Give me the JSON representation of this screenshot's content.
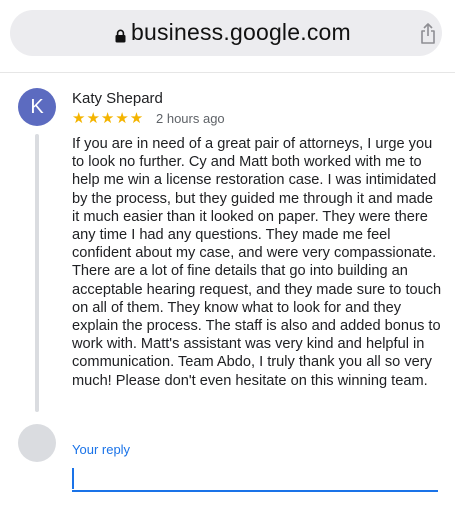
{
  "browser": {
    "url": "business.google.com",
    "lock_icon": "lock-icon",
    "share_icon": "share-icon"
  },
  "review": {
    "avatar_letter": "K",
    "avatar_color": "#5c6bc0",
    "author": "Katy Shepard",
    "rating": 5,
    "stars": "★★★★★",
    "star_color": "#f4b400",
    "time_ago": "2 hours ago",
    "text": "If you are in need of a great pair of attorneys, I urge you to look no further. Cy and Matt both worked with me to help me win a license restoration case. I was intimidated by the process, but they guided me through it and made it much easier than it looked on paper. They were there any time I had any questions. They made me feel confident about my case, and were very compassionate. There are a lot of fine details that go into building an acceptable hearing request, and they made sure to touch on all of them. They know what to look for and they explain the process. The staff is also and added bonus to work with. Matt's assistant was very kind and helpful in communication. Team Abdo, I truly thank you all so very much! Please don't even hesitate on this winning team."
  },
  "reply": {
    "label": "Your reply",
    "value": "",
    "accent_color": "#1a73e8"
  }
}
